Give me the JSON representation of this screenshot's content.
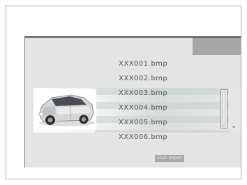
{
  "files": [
    {
      "label": "XXX001.bmp"
    },
    {
      "label": "XXX002.bmp"
    },
    {
      "label": "XXX003.bmp"
    },
    {
      "label": "XXX004.bmp"
    },
    {
      "label": "XXX005.bmp"
    },
    {
      "label": "XXX006.bmp"
    }
  ],
  "import_button": {
    "label": "Start Import"
  },
  "scroll_down_glyph": "⌄",
  "colors": {
    "screen_bg": "#e4e4e4",
    "corner_tab": "#a7a7a7",
    "button_bg": "#a9a9a9",
    "text": "#555555"
  }
}
